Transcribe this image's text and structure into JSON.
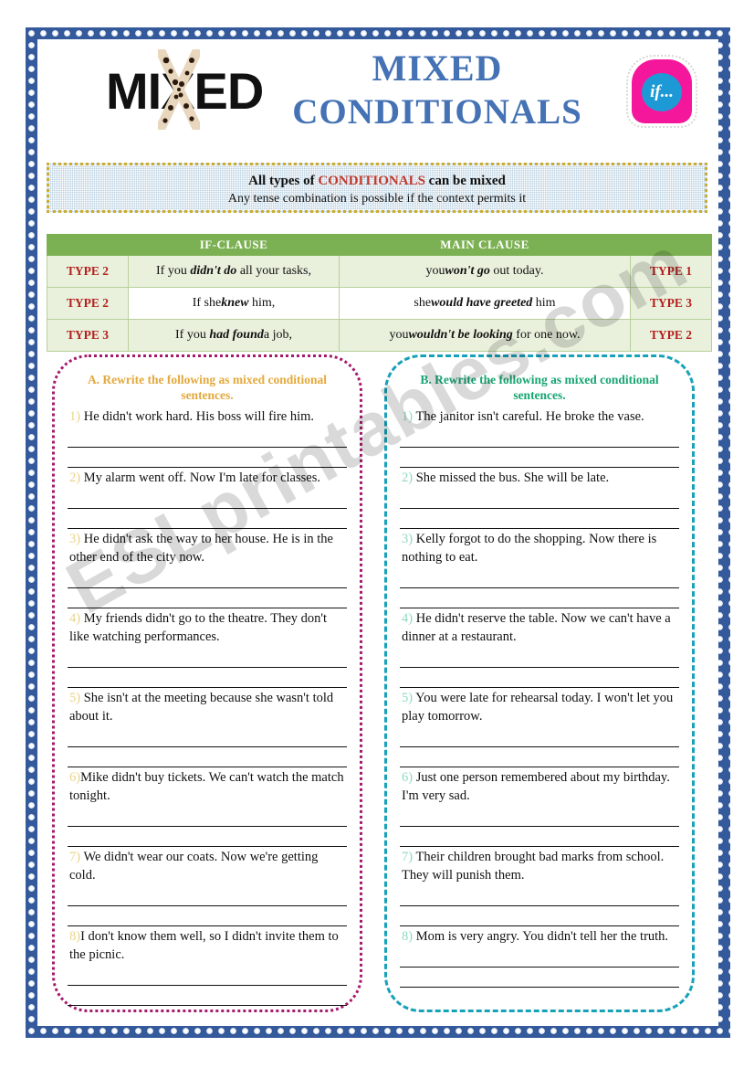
{
  "header": {
    "logo_text": "MIXED",
    "logo_x_decoration": "leopard-print-x",
    "title_line1": "MIXED",
    "title_line2": "CONDITIONALS",
    "if_badge_label": "if..."
  },
  "note_banner": {
    "line1_prefix": "All types of ",
    "line1_highlight": "CONDITIONALS",
    "line1_suffix": " can be mixed",
    "line2": "Any tense combination is possible if the context permits it",
    "highlight_color": "#c0392b",
    "background_color": "#b8cfe0",
    "border_color": "#ccad2e"
  },
  "table": {
    "headers": {
      "left_blank": "",
      "if_clause": "IF-CLAUSE",
      "main_clause": "MAIN CLAUSE",
      "right_blank": ""
    },
    "header_bg": "#7cb153",
    "type_color": "#b5201f",
    "rows": [
      {
        "left_type": "TYPE 2",
        "if_clause_plain_1": "If you ",
        "if_clause_bold": "didn't do",
        "if_clause_plain_2": " all your tasks,",
        "main_clause_plain_1": "you",
        "main_clause_bold": "won't go",
        "main_clause_plain_2": " out today.",
        "right_type": "TYPE 1"
      },
      {
        "left_type": "TYPE 2",
        "if_clause_plain_1": "If she",
        "if_clause_bold": "knew",
        "if_clause_plain_2": " him,",
        "main_clause_plain_1": "she",
        "main_clause_bold": "would have greeted",
        "main_clause_plain_2": " him",
        "right_type": "TYPE 3"
      },
      {
        "left_type": "TYPE 3",
        "if_clause_plain_1": "If you ",
        "if_clause_bold": "had found",
        "if_clause_plain_2": "a job,",
        "main_clause_plain_1": "you",
        "main_clause_bold": "wouldn't be looking",
        "main_clause_plain_2": " for one now.",
        "right_type": "TYPE 2"
      }
    ]
  },
  "exercise_a": {
    "heading": "A. Rewrite the following as mixed conditional sentences.",
    "heading_color": "#e3a93c",
    "border_color": "#a41b6d",
    "items": [
      {
        "num": "1)",
        "text": " He didn't work hard. His boss will fire him."
      },
      {
        "num": "2)",
        "text": " My alarm went off. Now I'm late for classes."
      },
      {
        "num": "3)",
        "text": " He didn't ask the way to her house. He is in the other end of the city now."
      },
      {
        "num": "4)",
        "text": " My friends didn't go to the theatre. They don't like watching performances."
      },
      {
        "num": "5)",
        "text": " She isn't at the meeting because she wasn't told about it."
      },
      {
        "num": "6)",
        "text": "Mike didn't buy tickets. We can't watch the match tonight."
      },
      {
        "num": "7)",
        "text": " We didn't wear our coats. Now we're getting cold."
      },
      {
        "num": "8)",
        "text": "I don't know them well, so I didn't invite them to the picnic."
      }
    ]
  },
  "exercise_b": {
    "heading": "B. Rewrite the following as mixed conditional sentences.",
    "heading_color": "#17a573",
    "border_color": "#17a2b8",
    "items": [
      {
        "num": "1)",
        "text": " The janitor isn't careful. He broke the vase."
      },
      {
        "num": "2)",
        "text": " She missed the bus. She will be late."
      },
      {
        "num": "3)",
        "text": " Kelly forgot to do the shopping. Now there is nothing to eat."
      },
      {
        "num": "4)",
        "text": " He didn't reserve the table. Now we can't have a dinner at a restaurant."
      },
      {
        "num": "5)",
        "text": " You were late for rehearsal today. I won't let you play tomorrow."
      },
      {
        "num": "6)",
        "text": " Just one person remembered about my birthday. I'm very sad."
      },
      {
        "num": "7)",
        "text": " Their children brought bad marks from school. They will punish them."
      },
      {
        "num": "8)",
        "text": " Mom is very angry. You didn't tell her the truth."
      }
    ]
  },
  "watermark": {
    "text": "ESLprintables.com"
  }
}
